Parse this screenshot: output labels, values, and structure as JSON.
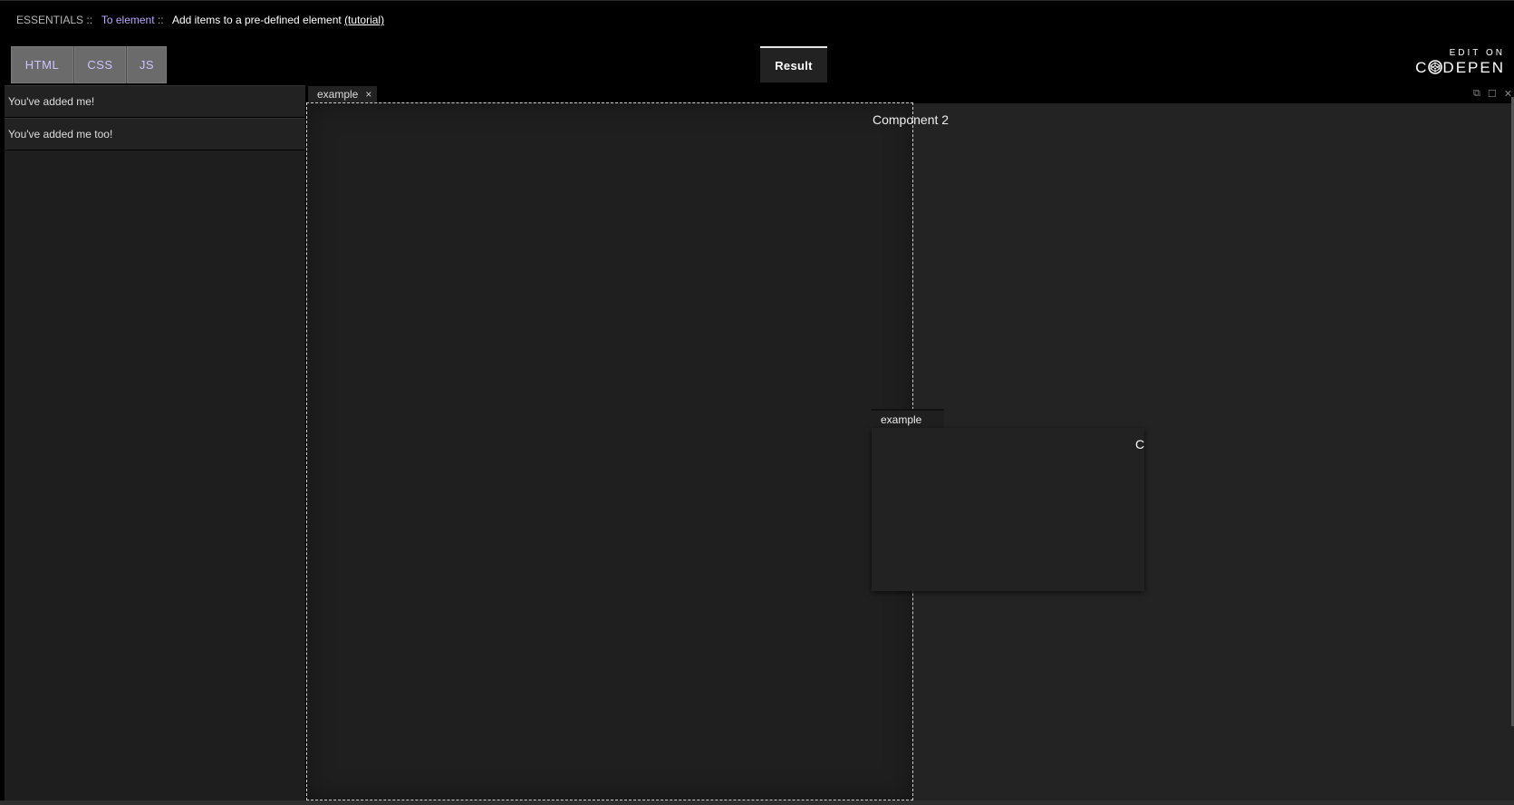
{
  "header": {
    "section": "ESSENTIALS",
    "separator": "::",
    "category": "To element",
    "title": "Add items to a pre-defined element",
    "tutorial_link": "(tutorial)"
  },
  "code_tabs": {
    "html_label": "HTML",
    "css_label": "CSS",
    "js_label": "JS"
  },
  "result_tab": {
    "label": "Result"
  },
  "codepen": {
    "edit_on": "EDIT ON",
    "brand_left": "C",
    "brand_right": "DEPEN"
  },
  "drag_source": {
    "items": [
      {
        "label": "You've added me!"
      },
      {
        "label": "You've added me too!"
      }
    ]
  },
  "layout": {
    "stack_tab": {
      "title": "example",
      "close": "×"
    },
    "component_content": "Component 2",
    "header_controls": {
      "popout": "⧉",
      "maximise": "☐",
      "close": "✕"
    }
  },
  "drag_proxy": {
    "tab_title": "example",
    "content_text": "C"
  },
  "colors": {
    "background": "#000000",
    "panel": "#222222",
    "accent_link": "#b9a7ff",
    "code_tab": "#6b6b6b"
  }
}
